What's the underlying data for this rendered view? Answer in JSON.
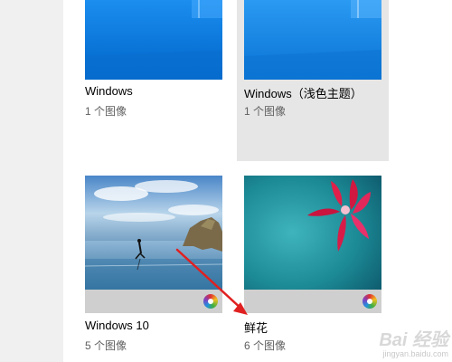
{
  "themes": [
    {
      "name": "Windows",
      "count": "1 个图像"
    },
    {
      "name": "Windows（浅色主题）",
      "count": "1 个图像"
    },
    {
      "name": "Windows 10",
      "count": "5 个图像"
    },
    {
      "name": "鲜花",
      "count": "6 个图像"
    }
  ],
  "watermark": {
    "brand": "Bai 经验",
    "url": "jingyan.baidu.com"
  },
  "colors": {
    "windows_blue": "#0a78d7",
    "annotation_arrow": "#e02020",
    "selected_tile_bg": "#e6e6e6",
    "theme_bar": "#cfcfcf"
  }
}
